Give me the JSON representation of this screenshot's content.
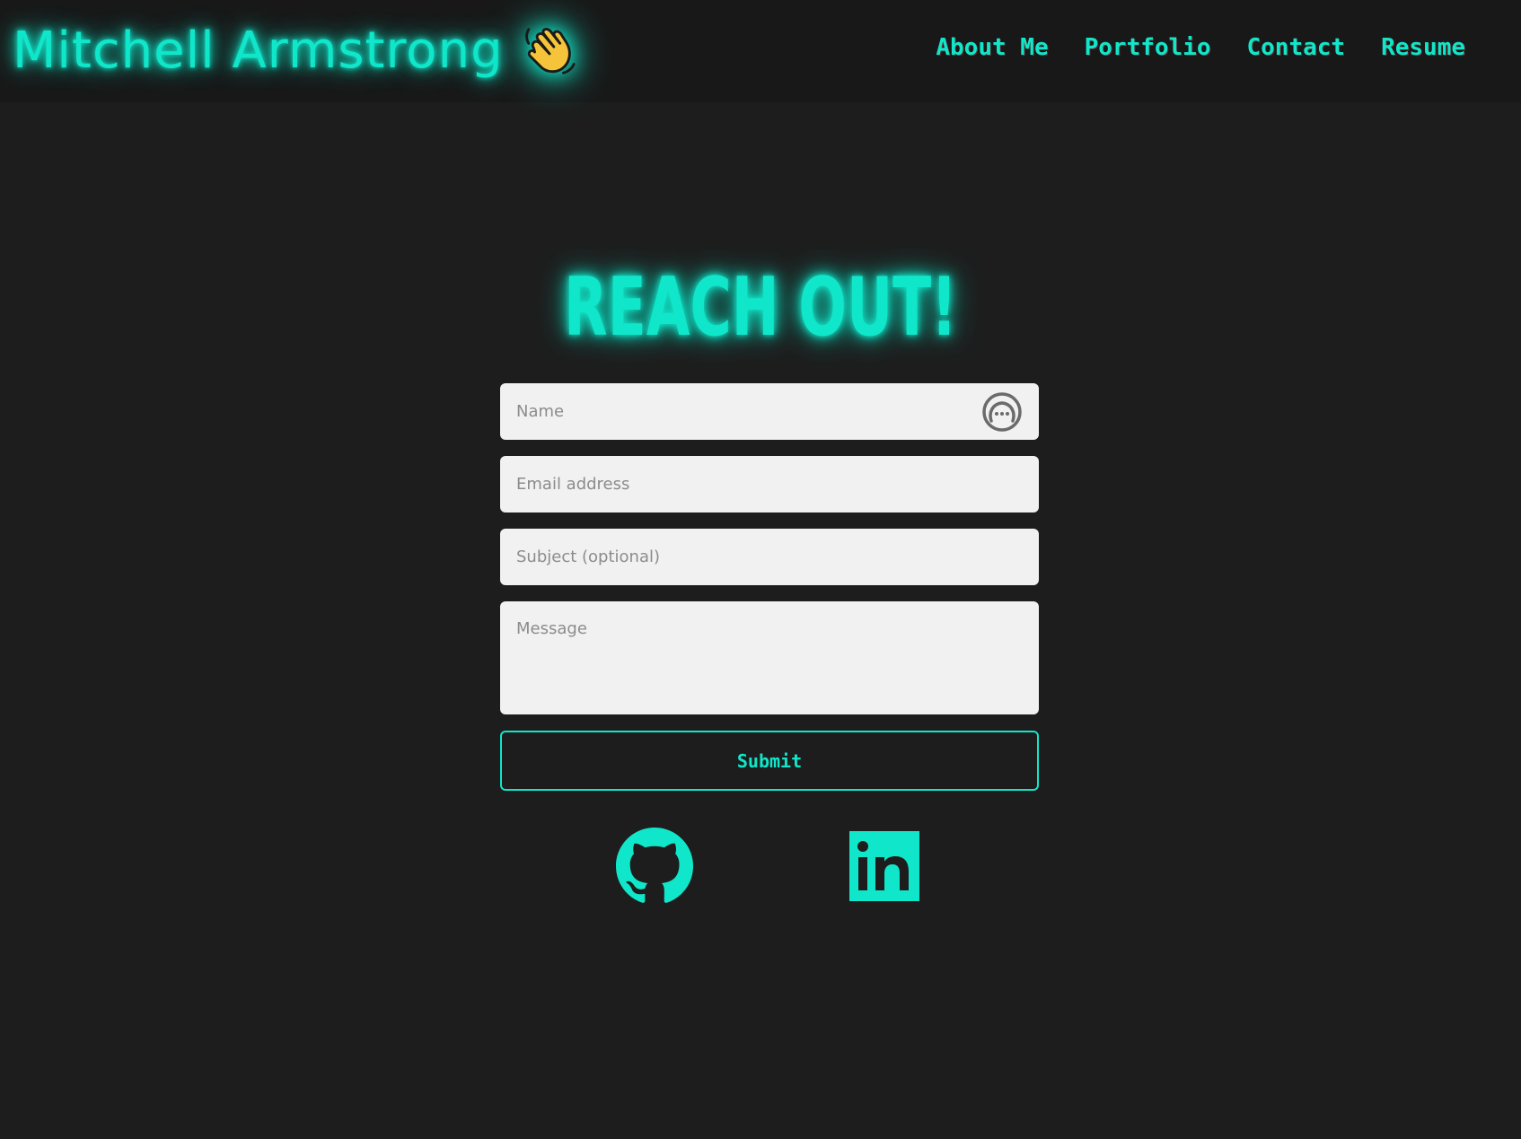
{
  "header": {
    "brand_name": "Mitchell Armstrong",
    "brand_emoji": "waving-hand-icon",
    "nav": [
      {
        "label": "About Me"
      },
      {
        "label": "Portfolio"
      },
      {
        "label": "Contact"
      },
      {
        "label": "Resume"
      }
    ]
  },
  "contact": {
    "heading": "REACH OUT!",
    "name_placeholder": "Name",
    "email_placeholder": "Email address",
    "subject_placeholder": "Subject (optional)",
    "message_placeholder": "Message",
    "submit_label": "Submit"
  },
  "socials": [
    {
      "icon": "github-icon"
    },
    {
      "icon": "linkedin-icon"
    }
  ],
  "colors": {
    "accent": "#10e6c9",
    "background": "#1d1d1d",
    "header_background": "#181818",
    "field_background": "#f1f1f1"
  }
}
